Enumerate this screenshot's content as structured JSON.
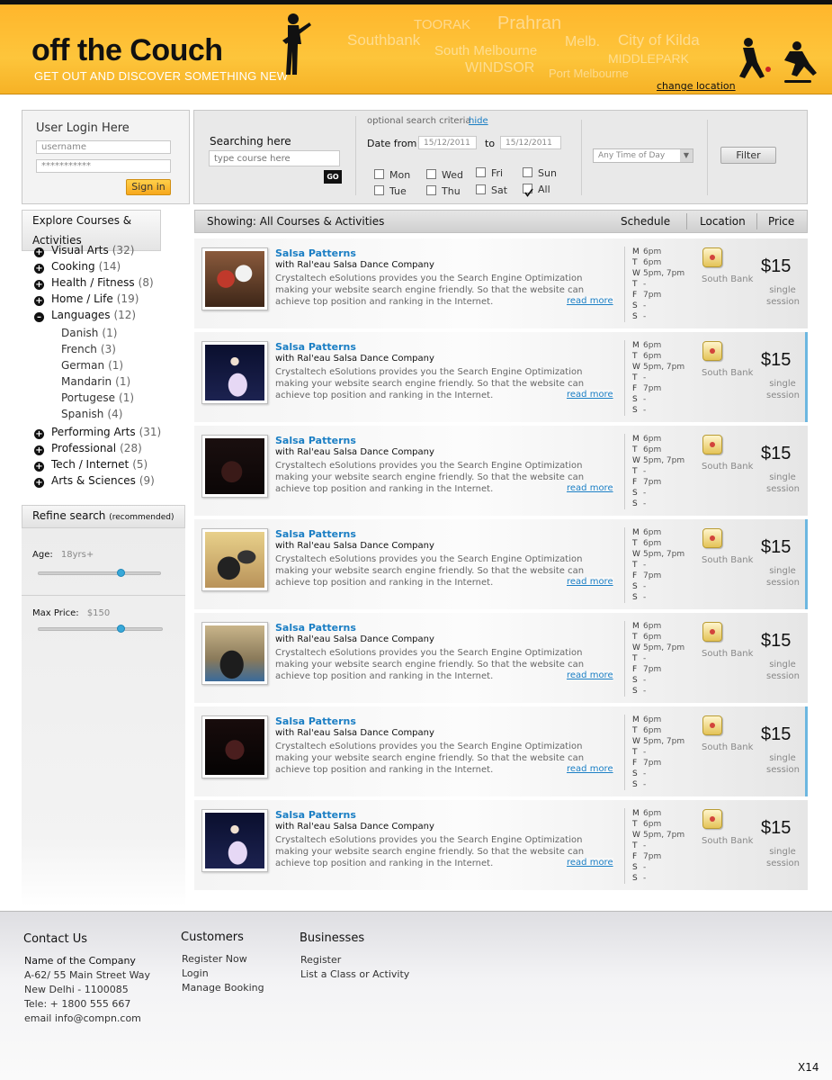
{
  "header": {
    "logo": "off the Couch",
    "tagline": "GET OUT AND DISCOVER SOMETHING NEW",
    "suburbs": [
      "TOORAK",
      "Prahran",
      "Southbank",
      "South Melbourne",
      "Melb.",
      "City of Kilda",
      "MIDDLEPARK",
      "WINDSOR",
      "Port Melbourne"
    ],
    "change_location": "change location"
  },
  "login": {
    "title": "User Login Here",
    "username_value": "username",
    "password_value": "***********",
    "signin": "Sign in"
  },
  "search": {
    "label": "Searching here",
    "placeholder": "type course here",
    "go": "GO",
    "optional_label": "optional search criteria",
    "hide": "hide",
    "date_from_label": "Date from",
    "date_from": "15/12/2011",
    "to_label": "to",
    "date_to": "15/12/2011",
    "days": [
      {
        "label": "Mon",
        "checked": false
      },
      {
        "label": "Wed",
        "checked": false
      },
      {
        "label": "Fri",
        "checked": false
      },
      {
        "label": "Sun",
        "checked": false
      },
      {
        "label": "Tue",
        "checked": false
      },
      {
        "label": "Thu",
        "checked": false
      },
      {
        "label": "Sat",
        "checked": false
      },
      {
        "label": "All",
        "checked": true
      }
    ],
    "time_select": "Any Time of Day",
    "filter": "Filter"
  },
  "explore": {
    "title": "Explore Courses & Activities",
    "categories_top": [
      {
        "label": "Visual Arts",
        "count": "(32)"
      },
      {
        "label": "Cooking",
        "count": "(14)"
      },
      {
        "label": "Health / Fitness",
        "count": "(8)"
      },
      {
        "label": "Home / Life",
        "count": "(19)"
      },
      {
        "label": "Languages",
        "count": "(12)"
      }
    ],
    "subcategories": [
      {
        "label": "Danish",
        "count": "(1)"
      },
      {
        "label": "French",
        "count": "(3)"
      },
      {
        "label": "German",
        "count": "(1)"
      },
      {
        "label": "Mandarin",
        "count": "(1)"
      },
      {
        "label": "Portugese",
        "count": "(1)"
      },
      {
        "label": "Spanish",
        "count": "(4)"
      }
    ],
    "categories_bottom": [
      {
        "label": "Performing Arts",
        "count": "(31)"
      },
      {
        "label": "Professional",
        "count": "(28)"
      },
      {
        "label": "Tech / Internet",
        "count": "(5)"
      },
      {
        "label": "Arts & Sciences",
        "count": "(9)"
      }
    ]
  },
  "refine": {
    "title": "Refine search",
    "note": "(recommended)",
    "age_label": "Age:",
    "age_value": "18yrs+",
    "age_level": 0.68,
    "price_label": "Max Price:",
    "price_value": "$150",
    "price_level": 0.67
  },
  "results": {
    "showing": "Showing: All Courses & Activities",
    "col_schedule": "Schedule",
    "col_location": "Location",
    "col_price": "Price",
    "items": [
      {
        "title": "Salsa Patterns",
        "company": "with Ral'eau Salsa Dance Company",
        "desc": "Crystaltech eSolutions provides you the Search Engine Optimization making your website search engine friendly. So that the website can achieve top position and ranking in the Internet.",
        "more": "read more",
        "schedule": [
          [
            "M",
            "6pm"
          ],
          [
            "T",
            "6pm"
          ],
          [
            "W",
            "5pm, 7pm"
          ],
          [
            "T",
            "-"
          ],
          [
            "F",
            "7pm"
          ],
          [
            "S",
            "-"
          ],
          [
            "S",
            "-"
          ]
        ],
        "location": "South Bank",
        "price": "$15",
        "unit": "single session",
        "selected": false
      },
      {
        "title": "Salsa Patterns",
        "company": "with Ral'eau Salsa Dance Company",
        "desc": "Crystaltech eSolutions provides you the Search Engine Optimization making your website search engine friendly. So that the website can achieve top position and ranking in the Internet.",
        "more": "read more",
        "schedule": [
          [
            "M",
            "6pm"
          ],
          [
            "T",
            "6pm"
          ],
          [
            "W",
            "5pm, 7pm"
          ],
          [
            "T",
            "-"
          ],
          [
            "F",
            "7pm"
          ],
          [
            "S",
            "-"
          ],
          [
            "S",
            "-"
          ]
        ],
        "location": "South Bank",
        "price": "$15",
        "unit": "single session",
        "selected": true
      },
      {
        "title": "Salsa Patterns",
        "company": "with Ral'eau Salsa Dance Company",
        "desc": "Crystaltech eSolutions provides you the Search Engine Optimization making your website search engine friendly. So that the website can achieve top position and ranking in the Internet.",
        "more": "read more",
        "schedule": [
          [
            "M",
            "6pm"
          ],
          [
            "T",
            "6pm"
          ],
          [
            "W",
            "5pm, 7pm"
          ],
          [
            "T",
            "-"
          ],
          [
            "F",
            "7pm"
          ],
          [
            "S",
            "-"
          ],
          [
            "S",
            "-"
          ]
        ],
        "location": "South Bank",
        "price": "$15",
        "unit": "single session",
        "selected": false
      },
      {
        "title": "Salsa Patterns",
        "company": "with Ral'eau Salsa Dance Company",
        "desc": "Crystaltech eSolutions provides you the Search Engine Optimization making your website search engine friendly. So that the website can achieve top position and ranking in the Internet.",
        "more": "read more",
        "schedule": [
          [
            "M",
            "6pm"
          ],
          [
            "T",
            "6pm"
          ],
          [
            "W",
            "5pm, 7pm"
          ],
          [
            "T",
            "-"
          ],
          [
            "F",
            "7pm"
          ],
          [
            "S",
            "-"
          ],
          [
            "S",
            "-"
          ]
        ],
        "location": "South Bank",
        "price": "$15",
        "unit": "single session",
        "selected": true
      },
      {
        "title": "Salsa Patterns",
        "company": "with Ral'eau Salsa Dance Company",
        "desc": "Crystaltech eSolutions provides you the Search Engine Optimization making your website search engine friendly. So that the website can achieve top position and ranking in the Internet.",
        "more": "read more",
        "schedule": [
          [
            "M",
            "6pm"
          ],
          [
            "T",
            "6pm"
          ],
          [
            "W",
            "5pm, 7pm"
          ],
          [
            "T",
            "-"
          ],
          [
            "F",
            "7pm"
          ],
          [
            "S",
            "-"
          ],
          [
            "S",
            "-"
          ]
        ],
        "location": "South Bank",
        "price": "$15",
        "unit": "single session",
        "selected": false
      },
      {
        "title": "Salsa Patterns",
        "company": "with Ral'eau Salsa Dance Company",
        "desc": "Crystaltech eSolutions provides you the Search Engine Optimization making your website search engine friendly. So that the website can achieve top position and ranking in the Internet.",
        "more": "read more",
        "schedule": [
          [
            "M",
            "6pm"
          ],
          [
            "T",
            "6pm"
          ],
          [
            "W",
            "5pm, 7pm"
          ],
          [
            "T",
            "-"
          ],
          [
            "F",
            "7pm"
          ],
          [
            "S",
            "-"
          ],
          [
            "S",
            "-"
          ]
        ],
        "location": "South Bank",
        "price": "$15",
        "unit": "single session",
        "selected": true
      },
      {
        "title": "Salsa Patterns",
        "company": "with Ral'eau Salsa Dance Company",
        "desc": "Crystaltech eSolutions provides you the Search Engine Optimization making your website search engine friendly. So that the website can achieve top position and ranking in the Internet.",
        "more": "read more",
        "schedule": [
          [
            "M",
            "6pm"
          ],
          [
            "T",
            "6pm"
          ],
          [
            "W",
            "5pm, 7pm"
          ],
          [
            "T",
            "-"
          ],
          [
            "F",
            "7pm"
          ],
          [
            "S",
            "-"
          ],
          [
            "S",
            "-"
          ]
        ],
        "location": "South Bank",
        "price": "$15",
        "unit": "single session",
        "selected": false
      }
    ]
  },
  "footer": {
    "contact_title": "Contact Us",
    "contact_lines": [
      "Name of the Company",
      "A-62/ 55 Main Street Way",
      "New Delhi - 1100085",
      "Tele: + 1800 555 667",
      "email  info@compn.com"
    ],
    "customers_title": "Customers",
    "customers_links": [
      "Register Now",
      "Login",
      "Manage Booking"
    ],
    "businesses_title": "Businesses",
    "businesses_links": [
      "Register",
      "List a Class or Activity"
    ],
    "page_code": "X14"
  },
  "colors": {
    "header": "#fdc53b",
    "link": "#1a7ec4",
    "accent_border": "#6cb7e0",
    "slider_knob": "#38a8d8"
  }
}
